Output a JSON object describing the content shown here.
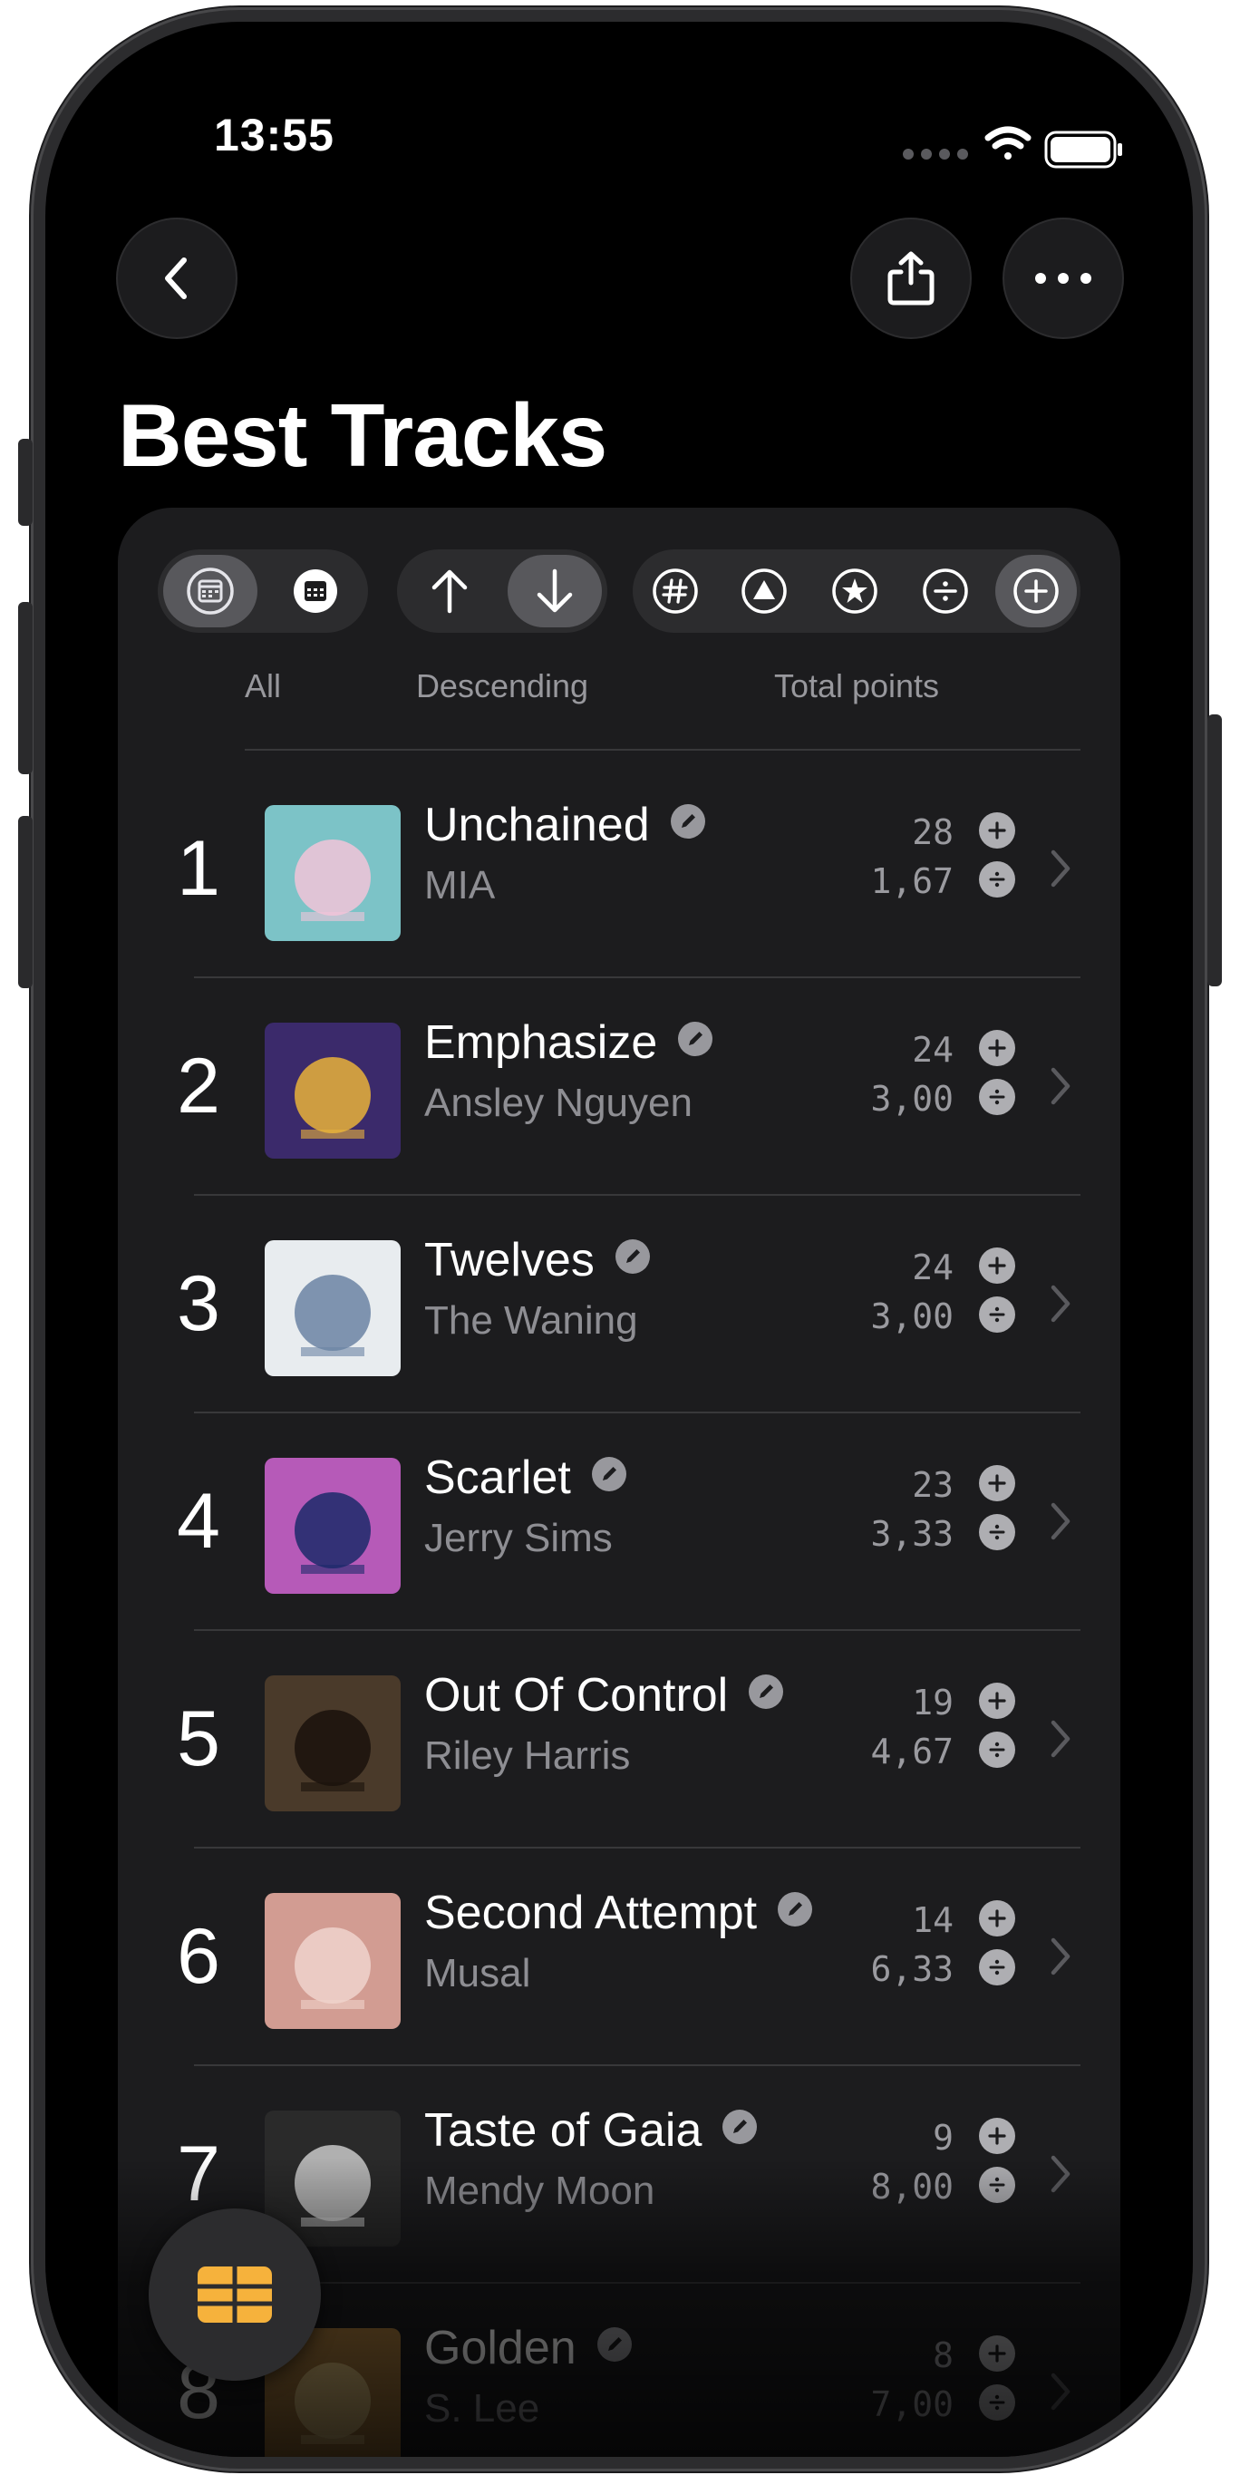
{
  "status_bar": {
    "time": "13:55"
  },
  "header": {
    "title": "Best Tracks"
  },
  "filters": {
    "period_label": "All",
    "order_label": "Descending",
    "metric_label": "Total points"
  },
  "tracks": [
    {
      "rank": "1",
      "title": "Unchained",
      "artist": "MIA",
      "points": "28",
      "average": "1,67",
      "art_bg": "#7cc3c7",
      "art_fg": "#f2c4d8"
    },
    {
      "rank": "2",
      "title": " Emphasize",
      "artist": "Ansley Nguyen",
      "points": "24",
      "average": "3,00",
      "art_bg": "#3b2a6b",
      "art_fg": "#e9b23a"
    },
    {
      "rank": "3",
      "title": "Twelves",
      "artist": "The Waning",
      "points": "24",
      "average": "3,00",
      "art_bg": "#e8ecef",
      "art_fg": "#6b84a3"
    },
    {
      "rank": "4",
      "title": "Scarlet",
      "artist": "Jerry Sims",
      "points": "23",
      "average": "3,33",
      "art_bg": "#b65ab8",
      "art_fg": "#1c2a6a"
    },
    {
      "rank": "5",
      "title": "Out Of Control",
      "artist": "Riley Harris",
      "points": "19",
      "average": "4,67",
      "art_bg": "#4a3a2a",
      "art_fg": "#1a120c"
    },
    {
      "rank": "6",
      "title": "Second Attempt",
      "artist": "Musal",
      "points": "14",
      "average": "6,33",
      "art_bg": "#d29c92",
      "art_fg": "#f0d3cc"
    },
    {
      "rank": "7",
      "title": "Taste of Gaia",
      "artist": "Mendy Moon",
      "points": "9",
      "average": "8,00",
      "art_bg": "#2a2a2a",
      "art_fg": "#c8c8c8"
    },
    {
      "rank": "8",
      "title": "Golden",
      "artist": "S. Lee",
      "points": "8",
      "average": "7,00",
      "art_bg": "#a77a3c",
      "art_fg": "#e7c983"
    }
  ]
}
